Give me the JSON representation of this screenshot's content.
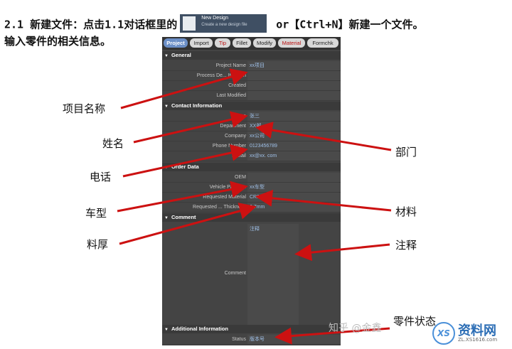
{
  "heading": {
    "line1_pre": "2.1  新建文件：点击1.1对话框里的",
    "line1_post": "or【Ctrl+N】新建一个文件。",
    "line2": "输入零件的相关信息。",
    "thumb_title": "New Design",
    "thumb_sub": "Create a new design file"
  },
  "tabs": [
    "Project",
    "Import",
    "Tip",
    "Fillet",
    "Modify",
    "Material",
    "Formchk"
  ],
  "sections": {
    "general": "General",
    "contact": "Contact Information",
    "order": "Order Data",
    "comment": "Comment",
    "additional": "Additional Information"
  },
  "rows": {
    "project_name": {
      "label": "Project Name",
      "value": "xx项目"
    },
    "process_de": {
      "label": "Process De... Iteration",
      "value": ""
    },
    "created": {
      "label": "Created",
      "value": ""
    },
    "last_modified": {
      "label": "Last Modified",
      "value": ""
    },
    "name": {
      "label": "Name",
      "value": "张三"
    },
    "department": {
      "label": "Department",
      "value": "XX部"
    },
    "company": {
      "label": "Company",
      "value": "xx公司"
    },
    "phone": {
      "label": "Phone Number",
      "value": "0123456789"
    },
    "email": {
      "label": "E-Mail",
      "value": "xx@xx. com"
    },
    "oem": {
      "label": "OEM",
      "value": ""
    },
    "vehicle": {
      "label": "Vehicle Program",
      "value": "xx车型"
    },
    "material": {
      "label": "Requested Material",
      "value": "CR3"
    },
    "thickness": {
      "label": "Requested ... Thickness",
      "value": "0.7mm"
    },
    "comment": {
      "label": "Comment",
      "value": "注释"
    },
    "status": {
      "label": "Status",
      "value": "版本号"
    }
  },
  "annotations": {
    "project_name": "项目名称",
    "name": "姓名",
    "department": "部门",
    "phone": "电话",
    "vehicle": "车型",
    "material": "材料",
    "thickness": "料厚",
    "comment": "注释",
    "status": "零件状态"
  },
  "watermark": "知乎 @金鑫",
  "logo": {
    "name": "资料网",
    "url": "ZL.XS1616.com"
  }
}
